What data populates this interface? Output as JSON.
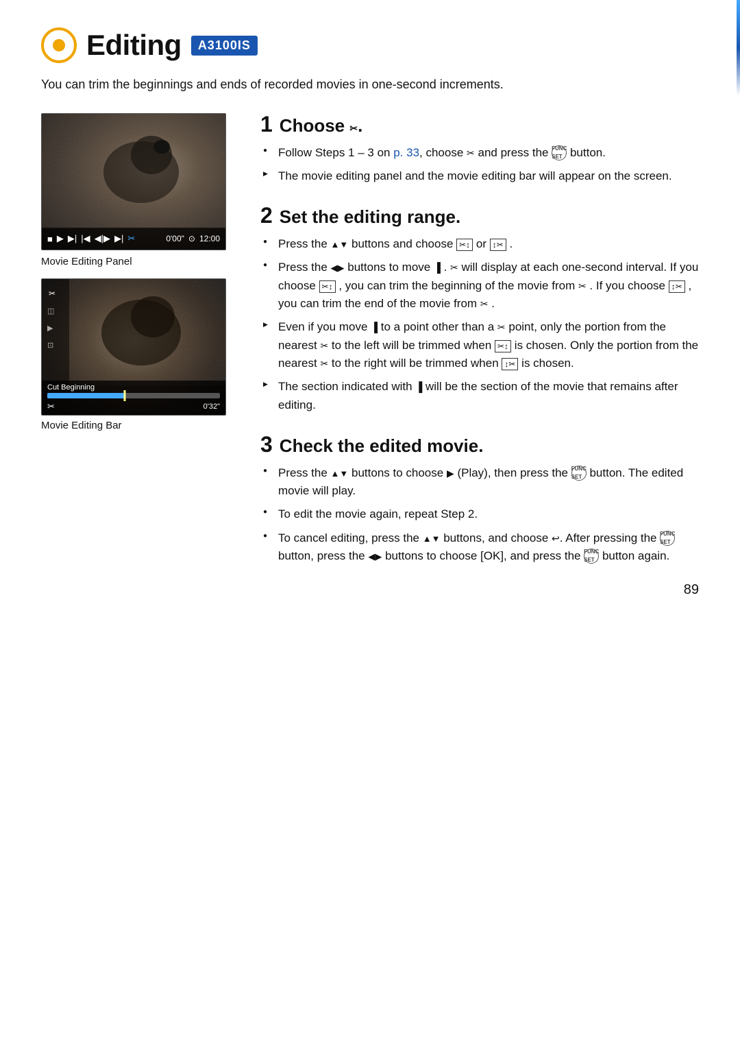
{
  "header": {
    "title": "Editing",
    "model": "A3100IS"
  },
  "intro": "You can trim the beginnings and ends of recorded movies in one-second increments.",
  "left_col": {
    "caption1": "Movie Editing Panel",
    "caption2": "Movie Editing Bar",
    "time_start": "0'00\"",
    "time_end": "12:00",
    "cut_label": "Cut Beginning",
    "cut_time": "0'32\""
  },
  "steps": [
    {
      "number": "1",
      "title": "Choose ✂.",
      "bullets": [
        {
          "type": "circle",
          "text": "Follow Steps 1 – 3 on p. 33, choose ✂ and press the FUNC/SET button."
        },
        {
          "type": "arrow",
          "text": "The movie editing panel and the movie editing bar will appear on the screen."
        }
      ]
    },
    {
      "number": "2",
      "title": "Set the editing range.",
      "bullets": [
        {
          "type": "circle",
          "text": "Press the ▲▼ buttons and choose ⊠↕ or ↕⊠ ."
        },
        {
          "type": "circle",
          "text": "Press the ◀▶ buttons to move ▐ . ✂ will display at each one-second interval. If you choose ⊠↕ , you can trim the beginning of the movie from ✂ . If you choose ↕⊠ , you can trim the end of the movie from ✂ ."
        },
        {
          "type": "arrow",
          "text": "Even if you move ▐ to a point other than a ✂ point, only the portion from the nearest ✂ to the left will be trimmed when ⊠↕ is chosen. Only the portion from the nearest ✂ to the right will be trimmed when ↕⊠ is chosen."
        },
        {
          "type": "arrow",
          "text": "The section indicated with ▐ will be the section of the movie that remains after editing."
        }
      ]
    },
    {
      "number": "3",
      "title": "Check the edited movie.",
      "bullets": [
        {
          "type": "circle",
          "text": "Press the ▲▼ buttons to choose ▶ (Play), then press the FUNC/SET button. The edited movie will play."
        },
        {
          "type": "circle",
          "text": "To edit the movie again, repeat Step 2."
        },
        {
          "type": "circle",
          "text": "To cancel editing, press the ▲▼ buttons, and choose ↩. After pressing the FUNC/SET button, press the ◀▶ buttons to choose [OK], and press the FUNC/SET button again."
        }
      ]
    }
  ],
  "page_number": "89"
}
